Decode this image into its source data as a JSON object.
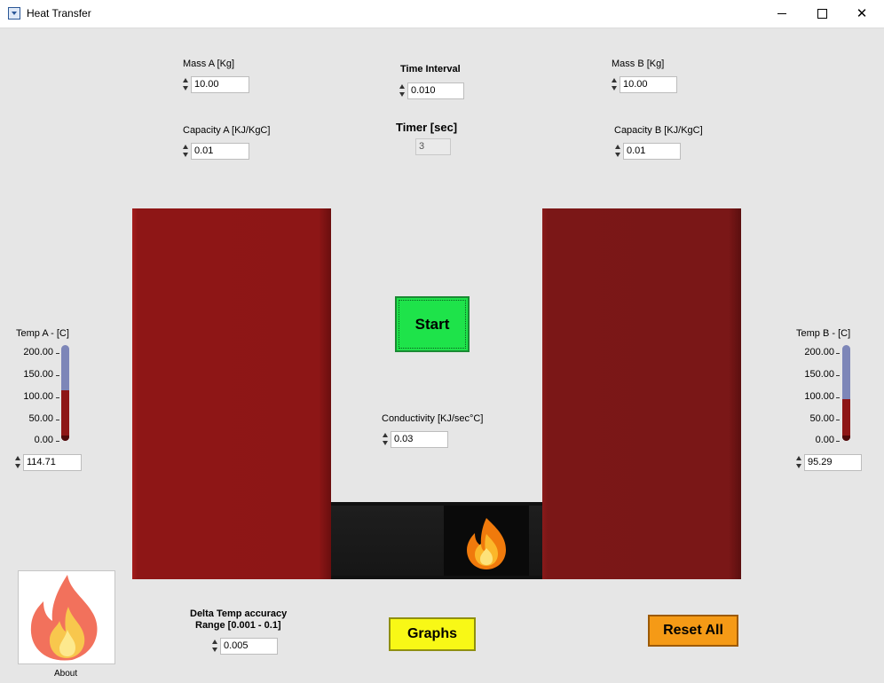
{
  "window": {
    "title": "Heat Transfer"
  },
  "mass_a": {
    "label": "Mass A [Kg]",
    "value": "10.00"
  },
  "capacity_a": {
    "label": "Capacity A [KJ/KgC]",
    "value": "0.01"
  },
  "mass_b": {
    "label": "Mass B [Kg]",
    "value": "10.00"
  },
  "capacity_b": {
    "label": "Capacity B [KJ/KgC]",
    "value": "0.01"
  },
  "time_interval": {
    "label": "Time Interval",
    "value": "0.010"
  },
  "timer": {
    "label": "Timer  [sec]",
    "value": "3"
  },
  "conductivity": {
    "label": "Conductivity [KJ/sec°C]",
    "value": "0.03"
  },
  "delta_temp": {
    "label_line1": "Delta Temp accuracy",
    "label_line2": "Range [0.001 - 0.1]",
    "value": "0.005"
  },
  "temp_a": {
    "label": "Temp A -  [C]",
    "value": "114.71",
    "level": 114.71,
    "scale_max": 200,
    "ticks": [
      "200.00",
      "150.00",
      "100.00",
      "50.00",
      "0.00"
    ]
  },
  "temp_b": {
    "label": "Temp B - [C]",
    "value": "95.29",
    "level": 95.29,
    "scale_max": 200,
    "ticks": [
      "200.00",
      "150.00",
      "100.00",
      "50.00",
      "0.00"
    ]
  },
  "buttons": {
    "start": "Start",
    "graphs": "Graphs",
    "reset": "Reset All"
  },
  "about": {
    "label": "About"
  },
  "colors": {
    "block_a": "#8e1616",
    "block_b": "#7a1717",
    "start": "#1ee34a",
    "graphs": "#f8f816",
    "reset": "#f59a16",
    "thermometer_fill": "#8e1616",
    "thermometer_empty": "#7d86b8"
  },
  "icons": {
    "app": "app-icon",
    "flame_heater": "flame-icon",
    "flame_about": "flame-icon"
  }
}
